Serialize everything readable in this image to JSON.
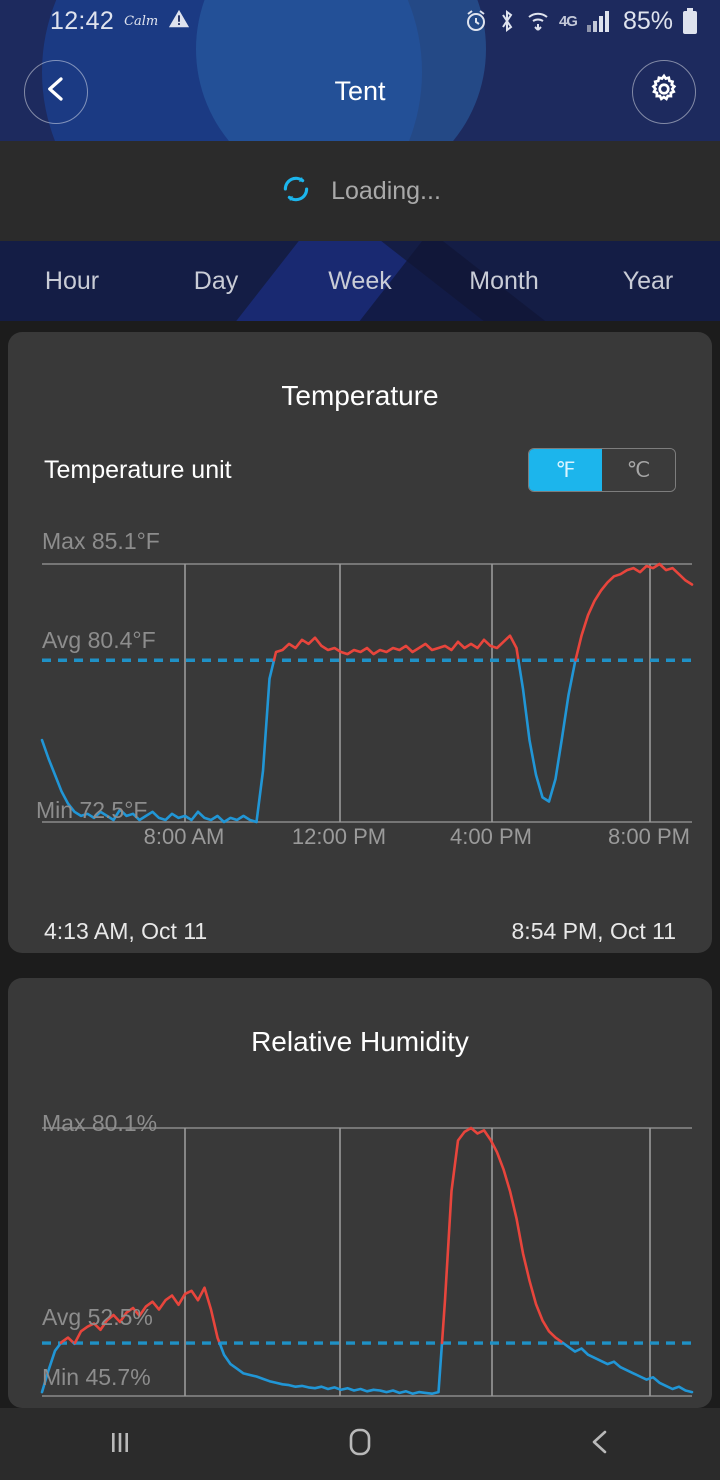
{
  "status_bar": {
    "time": "12:42",
    "profile_label": "Calm",
    "battery_percent": "85%",
    "network_type": "4G",
    "icons": [
      "warning-icon",
      "alarm-icon",
      "bluetooth-icon",
      "wifi-icon",
      "signal-icon",
      "battery-icon"
    ]
  },
  "header": {
    "title": "Tent",
    "back_icon": "chevron-left-icon",
    "settings_icon": "gear-icon",
    "bg_color": "#1d2a5e"
  },
  "loading": {
    "text": "Loading...",
    "icon": "refresh-spinner-icon",
    "accent": "#1cb5ec"
  },
  "tabs": {
    "items": [
      {
        "label": "Hour"
      },
      {
        "label": "Day"
      },
      {
        "label": "Week"
      },
      {
        "label": "Month"
      },
      {
        "label": "Year"
      }
    ],
    "selected": "Day"
  },
  "temperature_card": {
    "title": "Temperature",
    "unit_label": "Temperature unit",
    "unit_options": [
      {
        "label": "℉",
        "selected": true
      },
      {
        "label": "℃",
        "selected": false
      }
    ],
    "max_label": "Max 85.1°F",
    "avg_label": "Avg 80.4°F",
    "min_label": "Min 72.5°F",
    "range_start": "4:13 AM,  Oct 11",
    "range_end": "8:54 PM,  Oct 11"
  },
  "humidity_card": {
    "title": "Relative Humidity",
    "max_label": "Max 80.1%",
    "avg_label": "Avg 52.5%",
    "min_label": "Min 45.7%"
  },
  "nav_bar": {
    "recents_icon": "recents-icon",
    "home_icon": "home-icon",
    "back_icon": "back-icon"
  },
  "colors": {
    "accent_cyan": "#1cb5ec",
    "line_cold": "#2196d6",
    "line_hot": "#e8453c",
    "card_bg": "#393939",
    "page_bg": "#1c1c1c"
  },
  "chart_data": [
    {
      "id": "temperature",
      "type": "line",
      "title": "Temperature",
      "xlabel": "",
      "ylabel": "°F",
      "ylim": [
        72.5,
        85.1
      ],
      "grid": true,
      "legend": "none",
      "x_tick_labels": [
        "8:00 AM",
        "12:00 PM",
        "4:00 PM",
        "8:00 PM"
      ],
      "x_tick_positions_pct": [
        25.1,
        47.0,
        68.5,
        91.0
      ],
      "annotations": {
        "max": 85.1,
        "avg": 80.4,
        "min": 72.5,
        "avg_line_style": "dashed",
        "avg_line_color": "#1f91c6"
      },
      "time_range": {
        "start": "4:13 AM, Oct 11",
        "end": "8:54 PM, Oct 11"
      },
      "threshold_note": "segments above avg drawn red, below avg drawn blue",
      "series": [
        {
          "name": "Temperature",
          "units": "°F",
          "x": [
            0,
            1,
            2,
            3,
            4,
            5,
            6,
            7,
            8,
            9,
            10,
            11,
            12,
            13,
            14,
            15,
            16,
            17,
            18,
            19,
            20,
            21,
            22,
            23,
            24,
            25,
            26,
            27,
            28,
            29,
            30,
            31,
            32,
            33,
            34,
            35,
            36,
            37,
            38,
            39,
            40,
            41,
            42,
            43,
            44,
            45,
            46,
            47,
            48,
            49,
            50,
            51,
            52,
            53,
            54,
            55,
            56,
            57,
            58,
            59,
            60,
            61,
            62,
            63,
            64,
            65,
            66,
            67,
            68,
            69,
            70,
            71,
            72,
            73,
            74,
            75,
            76,
            77,
            78,
            79,
            80,
            81,
            82,
            83,
            84,
            85,
            86,
            87,
            88,
            89,
            90,
            91,
            92,
            93,
            94,
            95,
            96,
            97,
            98,
            99,
            100
          ],
          "values": [
            76.5,
            75.6,
            74.8,
            74.0,
            73.4,
            73.0,
            72.8,
            72.9,
            72.7,
            73.0,
            72.8,
            72.6,
            73.1,
            72.8,
            72.9,
            72.6,
            72.8,
            73.0,
            72.7,
            72.6,
            72.9,
            72.7,
            72.8,
            72.6,
            73.0,
            72.7,
            72.6,
            72.8,
            72.5,
            72.7,
            72.6,
            72.8,
            72.6,
            72.5,
            75.0,
            79.5,
            80.8,
            80.9,
            81.2,
            81.0,
            81.4,
            81.2,
            81.5,
            81.1,
            80.9,
            81.0,
            80.8,
            80.7,
            80.9,
            80.8,
            81.0,
            80.7,
            80.9,
            80.8,
            81.0,
            80.9,
            81.1,
            80.8,
            81.0,
            81.2,
            80.9,
            81.0,
            81.1,
            80.9,
            81.3,
            81.0,
            81.2,
            81.0,
            81.4,
            81.1,
            81.0,
            81.3,
            81.6,
            81.0,
            79.0,
            76.5,
            74.8,
            73.7,
            73.5,
            74.6,
            76.6,
            78.7,
            80.3,
            81.6,
            82.6,
            83.3,
            83.8,
            84.2,
            84.5,
            84.6,
            84.8,
            84.9,
            84.7,
            85.0,
            84.9,
            85.1,
            84.8,
            84.9,
            84.6,
            84.3,
            84.1
          ],
          "color_above_avg": "#e8453c",
          "color_below_avg": "#2196d6"
        }
      ]
    },
    {
      "id": "relative_humidity",
      "type": "line",
      "title": "Relative Humidity",
      "xlabel": "",
      "ylabel": "%",
      "ylim": [
        45.7,
        80.1
      ],
      "grid": true,
      "legend": "none",
      "annotations": {
        "max": 80.1,
        "avg": 52.5,
        "min": 45.7,
        "avg_line_style": "dashed",
        "avg_line_color": "#1f91c6"
      },
      "series": [
        {
          "name": "Relative Humidity",
          "units": "%",
          "x": [
            0,
            1,
            2,
            3,
            4,
            5,
            6,
            7,
            8,
            9,
            10,
            11,
            12,
            13,
            14,
            15,
            16,
            17,
            18,
            19,
            20,
            21,
            22,
            23,
            24,
            25,
            26,
            27,
            28,
            29,
            30,
            31,
            32,
            33,
            34,
            35,
            36,
            37,
            38,
            39,
            40,
            41,
            42,
            43,
            44,
            45,
            46,
            47,
            48,
            49,
            50,
            51,
            52,
            53,
            54,
            55,
            56,
            57,
            58,
            59,
            60,
            61,
            62,
            63,
            64,
            65,
            66,
            67,
            68,
            69,
            70,
            71,
            72,
            73,
            74,
            75,
            76,
            77,
            78,
            79,
            80,
            81,
            82,
            83,
            84,
            85,
            86,
            87,
            88,
            89,
            90,
            91,
            92,
            93,
            94,
            95,
            96,
            97,
            98,
            99,
            100
          ],
          "values": [
            46.2,
            49.0,
            51.5,
            52.6,
            53.2,
            52.4,
            54.0,
            54.6,
            55.0,
            54.2,
            55.4,
            56.1,
            55.2,
            56.4,
            57.0,
            56.0,
            57.2,
            57.8,
            56.8,
            58.0,
            58.6,
            57.4,
            58.8,
            59.2,
            58.0,
            59.6,
            56.8,
            53.2,
            51.0,
            49.8,
            49.2,
            48.6,
            48.4,
            48.2,
            47.9,
            47.6,
            47.4,
            47.2,
            47.1,
            46.9,
            47.0,
            46.8,
            46.7,
            46.9,
            46.6,
            46.8,
            46.5,
            46.7,
            46.4,
            46.6,
            46.3,
            46.5,
            46.4,
            46.2,
            46.4,
            46.1,
            46.3,
            46.0,
            46.2,
            46.1,
            46.0,
            46.2,
            58.0,
            72.0,
            78.5,
            79.6,
            80.1,
            79.4,
            79.8,
            78.6,
            77.0,
            74.8,
            72.0,
            68.5,
            64.0,
            60.5,
            57.5,
            55.4,
            54.0,
            53.2,
            52.6,
            52.0,
            51.4,
            51.8,
            51.0,
            50.6,
            50.2,
            49.8,
            50.1,
            49.4,
            49.0,
            48.6,
            48.2,
            47.8,
            48.1,
            47.4,
            47.0,
            46.6,
            46.9,
            46.4,
            46.2
          ],
          "color_above_avg": "#e8453c",
          "color_below_avg": "#2196d6"
        }
      ]
    }
  ]
}
